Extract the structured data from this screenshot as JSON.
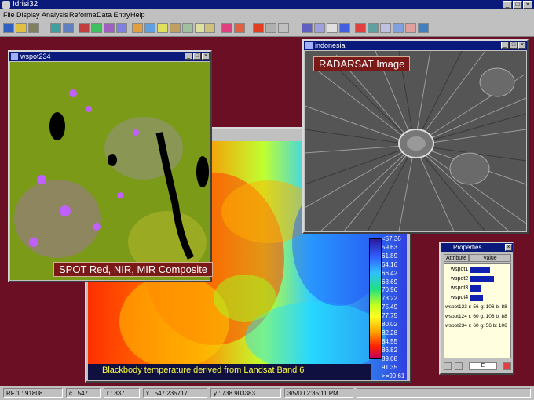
{
  "app": {
    "title": "Idrisi32"
  },
  "menu": [
    "File",
    "Display",
    "Analysis",
    "Reformat",
    "Data Entry",
    "Help"
  ],
  "windows": {
    "spot": {
      "title": "wspot234",
      "label": "SPOT Red, NIR, MIR Composite"
    },
    "radarsat": {
      "title": "indonesia",
      "label": "RADARSAT Image"
    },
    "landsat": {
      "label": "Blackbody temperature derived from Landsat Band 6"
    }
  },
  "legend": [
    "<57.36",
    "59.63",
    "61.89",
    "64.16",
    "66.42",
    "68.69",
    "70.96",
    "73.22",
    "75.49",
    "77.75",
    "80.02",
    "82.28",
    "84.55",
    "86.82",
    "89.08",
    "91.35",
    ">=90.61"
  ],
  "properties": {
    "title": "Properties",
    "col_attribute": "Attribute",
    "col_value": "Value",
    "rows": [
      {
        "name": "wspot1",
        "value": 0.55
      },
      {
        "name": "wspot2",
        "value": 0.65
      },
      {
        "name": "wspot3",
        "value": 0.3
      },
      {
        "name": "wspot4",
        "value": 0.35
      }
    ],
    "info": [
      "wspot123 r: 56 g: 106 b: 88",
      "wspot124 r: 60 g: 106 b: 88",
      "wspot234 r: 60 g: 56 b: 106"
    ],
    "field_value": "E"
  },
  "status": {
    "rf": "RF 1 : 91808",
    "c": "c : 547",
    "r": "r : 837",
    "x": "x : 547.235717",
    "y": "y : 738.903383",
    "datetime": "3/5/00 2:35:11 PM"
  }
}
